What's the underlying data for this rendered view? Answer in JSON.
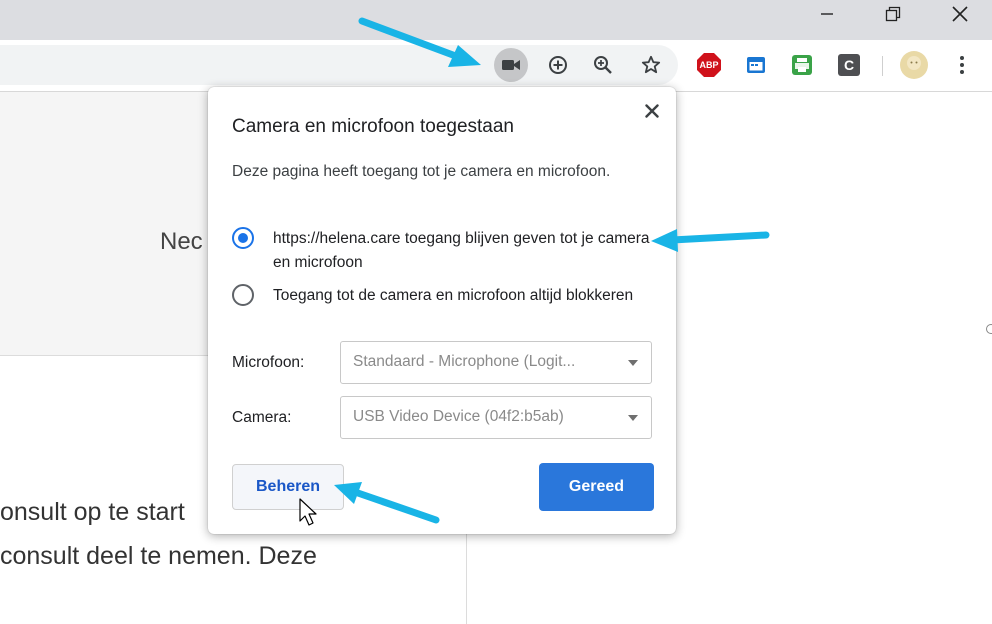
{
  "colors": {
    "accent": "#1a73e8",
    "done_button": "#2a77db",
    "annotation_arrow": "#19b4e6"
  },
  "window_controls": {
    "minimize_icon": "minimize-icon",
    "restore_icon": "restore-icon",
    "close_icon": "close-icon"
  },
  "toolbar": {
    "icons": [
      "camera-icon",
      "install-icon",
      "zoom-icon",
      "star-icon"
    ],
    "extensions": {
      "adblock": "ABP",
      "c_extension": "C"
    }
  },
  "page": {
    "heading_partial": "Nec",
    "body_lines": [
      "onsult op te start",
      " consult deel te nemen. Deze"
    ]
  },
  "dialog": {
    "title": "Camera en microfoon toegestaan",
    "description": "Deze pagina heeft toegang tot je camera en microfoon.",
    "options": [
      {
        "label": "https://helena.care toegang blijven geven tot je camera en microfoon",
        "checked": true
      },
      {
        "label": "Toegang tot de camera en microfoon altijd blokkeren",
        "checked": false
      }
    ],
    "microphone": {
      "label": "Microfoon:",
      "value": "Standaard - Microphone (Logit..."
    },
    "camera": {
      "label": "Camera:",
      "value": "USB Video Device (04f2:b5ab)"
    },
    "manage_button": "Beheren",
    "done_button": "Gereed"
  }
}
